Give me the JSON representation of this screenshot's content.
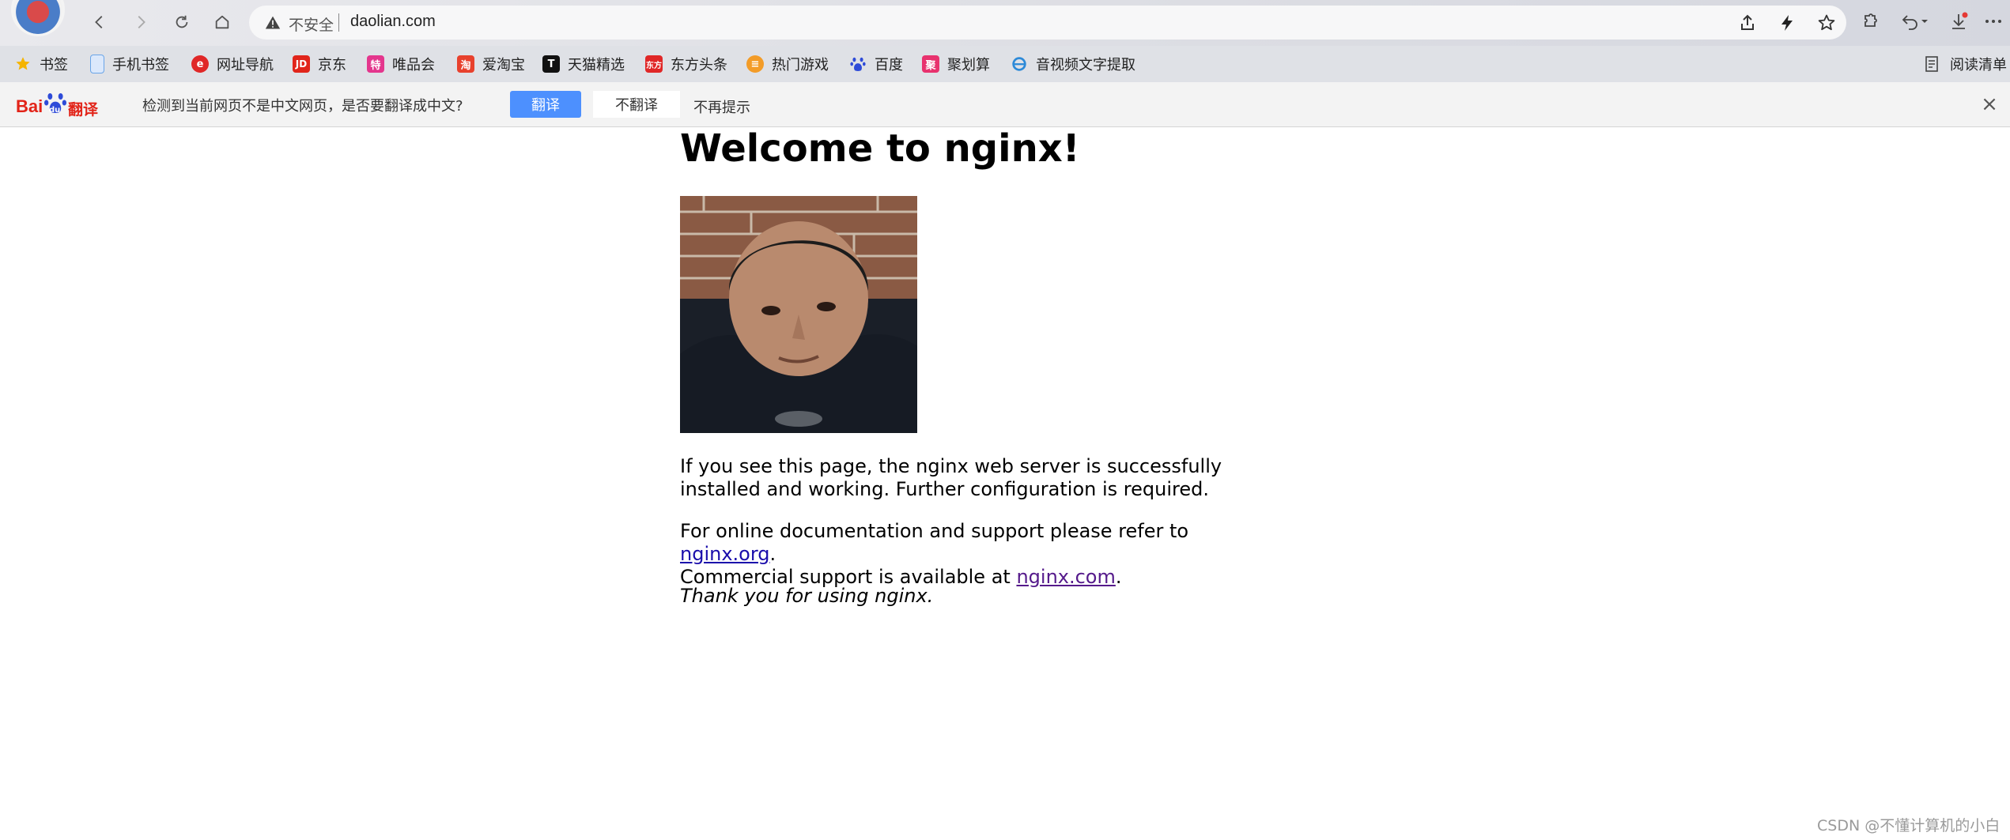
{
  "address_bar": {
    "security_text": "不安全",
    "url": "daolian.com"
  },
  "bookmarks": [
    {
      "label": "书签",
      "icon": "star-icon",
      "color": "#f5b400"
    },
    {
      "label": "手机书签",
      "icon": "phone-icon",
      "color": "#6aa5e8"
    },
    {
      "label": "网址导航",
      "icon": "nav-icon",
      "color": "#e02727"
    },
    {
      "label": "京东",
      "icon": "jd-icon",
      "color": "#e1251b"
    },
    {
      "label": "唯品会",
      "icon": "vip-icon",
      "color": "#e4368d"
    },
    {
      "label": "爱淘宝",
      "icon": "taobao-icon",
      "color": "#e8412d"
    },
    {
      "label": "天猫精选",
      "icon": "tmall-icon",
      "color": "#111111"
    },
    {
      "label": "东方头条",
      "icon": "toutiao-icon",
      "color": "#e02727"
    },
    {
      "label": "热门游戏",
      "icon": "game-icon",
      "color": "#f39c28"
    },
    {
      "label": "百度",
      "icon": "baidu-icon",
      "color": "#2e4bd8"
    },
    {
      "label": "聚划算",
      "icon": "juhuasuan-icon",
      "color": "#e8326e"
    },
    {
      "label": "音视频文字提取",
      "icon": "ie-icon",
      "color": "#2d8ad8"
    }
  ],
  "reading_list": "阅读清单",
  "translate_bar": {
    "brand_left": "Bai",
    "brand_mid": "du",
    "brand_right": "翻译",
    "message": "检测到当前网页不是中文网页，是否要翻译成中文?",
    "translate_label": "翻译",
    "no_translate_label": "不翻译",
    "never_label": "不再提示"
  },
  "page": {
    "heading": "Welcome to nginx!",
    "p1": "If you see this page, the nginx web server is successfully installed and working. Further configuration is required.",
    "p2_pre": "For online documentation and support please refer to ",
    "link_org": "nginx.org",
    "p2_mid": ".",
    "p2_line2": "Commercial support is available at ",
    "link_com": "nginx.com",
    "p2_end": ".",
    "p3": "Thank you for using nginx."
  },
  "watermark": "CSDN @不懂计算机的小白",
  "colors": {
    "translate_button": "#4d90fe",
    "link": "#1a0dab",
    "visited_link": "#551a8b"
  }
}
